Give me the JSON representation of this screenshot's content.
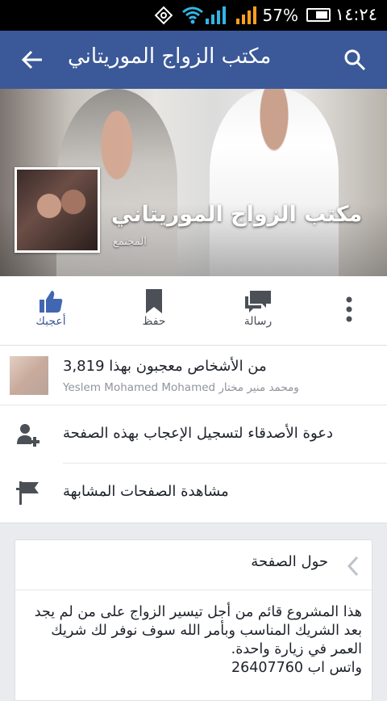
{
  "status_bar": {
    "battery_percent": "57%",
    "time": "١٤:٢٤",
    "icons": [
      "rotation-icon",
      "wifi-icon",
      "signal-icon",
      "signal-icon",
      "battery-icon"
    ]
  },
  "app_bar": {
    "title": "مكتب الزواج الموريتاني",
    "back_icon": "back-arrow-icon",
    "search_icon": "search-icon",
    "color": "#3b5998"
  },
  "cover": {
    "page_name": "مكتب الزواج الموريتاني",
    "category": "المجتمع"
  },
  "actions": [
    {
      "label": "أعجبك",
      "icon": "like-icon",
      "active": true
    },
    {
      "label": "حفظ",
      "icon": "bookmark-icon"
    },
    {
      "label": "رسالة",
      "icon": "message-icon"
    },
    {
      "label": "",
      "icon": "more-icon"
    }
  ],
  "likes": {
    "count_text": "3,819 من الأشخاص معجبون بهذا",
    "names_text": "Yeslem Mohamed Mohamed ومحمد منير مختار"
  },
  "rows": {
    "invite_label": "دعوة الأصدقاء لتسجيل الإعجاب بهذه الصفحة",
    "similar_label": "مشاهدة الصفحات المشابهة"
  },
  "about": {
    "title": "حول الصفحة",
    "body": "هذا المشروع قائم من أجل تيسير الزواج على من لم يجد بعد الشريك المناسب وبأمر الله سوف نوفر لك شريك العمر في زيارة واحدة.",
    "phone": "واتس اب 26407760"
  },
  "colors": {
    "accent": "#3b5998",
    "background": "#e9ebee"
  }
}
